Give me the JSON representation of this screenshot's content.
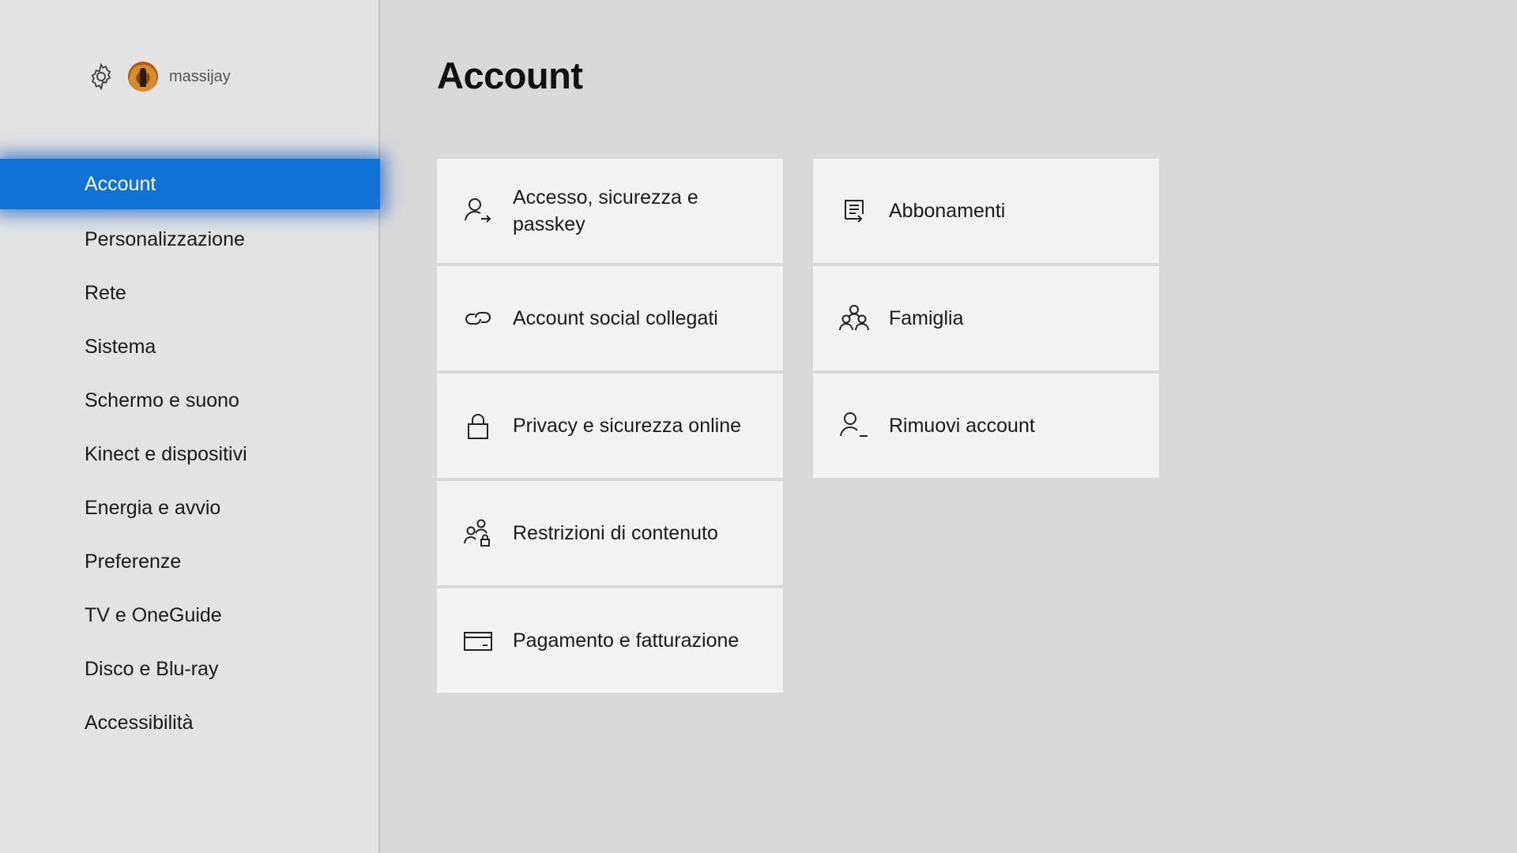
{
  "profile": {
    "username": "massijay"
  },
  "nav": {
    "items": [
      {
        "label": "Account",
        "selected": true
      },
      {
        "label": "Personalizzazione"
      },
      {
        "label": "Rete"
      },
      {
        "label": "Sistema"
      },
      {
        "label": "Schermo e suono"
      },
      {
        "label": "Kinect e dispositivi"
      },
      {
        "label": "Energia e avvio"
      },
      {
        "label": "Preferenze"
      },
      {
        "label": "TV e OneGuide"
      },
      {
        "label": "Disco e Blu-ray"
      },
      {
        "label": "Accessibilità"
      }
    ]
  },
  "main": {
    "title": "Account",
    "tiles": [
      {
        "label": "Accesso, sicurezza e passkey",
        "icon": "user-arrow-icon"
      },
      {
        "label": "Account social collegati",
        "icon": "link-icon"
      },
      {
        "label": "Privacy e sicurezza online",
        "icon": "lock-icon"
      },
      {
        "label": "Restrizioni di contenuto",
        "icon": "users-lock-icon"
      },
      {
        "label": "Pagamento e fatturazione",
        "icon": "credit-card-icon"
      },
      {
        "label": "Abbonamenti",
        "icon": "document-list-icon"
      },
      {
        "label": "Famiglia",
        "icon": "family-icon"
      },
      {
        "label": "Rimuovi account",
        "icon": "user-remove-icon"
      }
    ]
  },
  "colors": {
    "accent": "#1172d6",
    "background": "#d9d9d9",
    "sidebar": "#e3e3e3",
    "tile": "#f2f2f2"
  }
}
